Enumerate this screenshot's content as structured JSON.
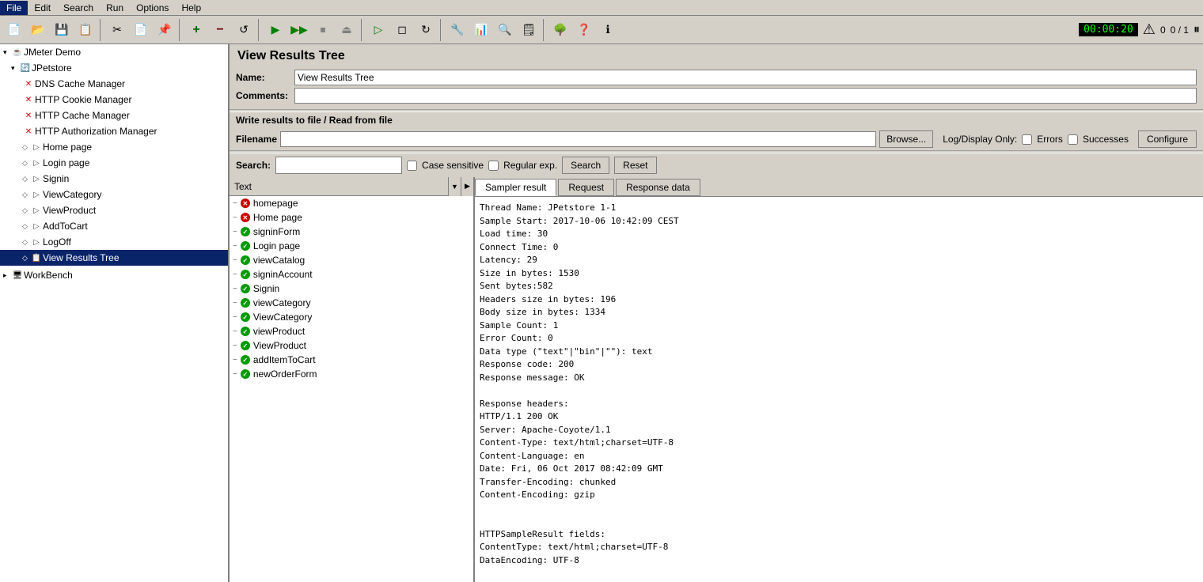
{
  "menubar": {
    "items": [
      "File",
      "Edit",
      "Search",
      "Run",
      "Options",
      "Help"
    ]
  },
  "toolbar": {
    "buttons": [
      {
        "name": "new-btn",
        "icon": "📄"
      },
      {
        "name": "open-btn",
        "icon": "📂"
      },
      {
        "name": "save-btn",
        "icon": "💾"
      },
      {
        "name": "save-as-btn",
        "icon": "💾"
      },
      {
        "name": "cut-btn",
        "icon": "✂"
      },
      {
        "name": "copy-btn",
        "icon": "📋"
      },
      {
        "name": "paste-btn",
        "icon": "📌"
      },
      {
        "name": "sep1",
        "type": "sep"
      },
      {
        "name": "add-btn",
        "icon": "+"
      },
      {
        "name": "remove-btn",
        "icon": "−"
      },
      {
        "name": "clear-btn",
        "icon": "↺"
      },
      {
        "name": "sep2",
        "type": "sep"
      },
      {
        "name": "run-btn",
        "icon": "▶"
      },
      {
        "name": "run-no-stop-btn",
        "icon": "▶▶"
      },
      {
        "name": "stop-btn",
        "icon": "⏹"
      },
      {
        "name": "shutdown-btn",
        "icon": "⏏"
      },
      {
        "name": "sep3",
        "type": "sep"
      },
      {
        "name": "remote-start-btn",
        "icon": "▷"
      },
      {
        "name": "remote-stop-btn",
        "icon": "◻"
      },
      {
        "name": "remote-clear-btn",
        "icon": "↻"
      },
      {
        "name": "sep4",
        "type": "sep"
      },
      {
        "name": "func-test-btn",
        "icon": "🔧"
      },
      {
        "name": "report-btn",
        "icon": "📊"
      },
      {
        "name": "monitor-btn",
        "icon": "🔍"
      },
      {
        "name": "log-btn",
        "icon": "📝"
      },
      {
        "name": "sep5",
        "type": "sep"
      },
      {
        "name": "tree-view-btn",
        "icon": "🌳"
      },
      {
        "name": "help-btn",
        "icon": "❓"
      },
      {
        "name": "info-btn",
        "icon": "ℹ"
      }
    ],
    "timer": "00:00:20",
    "warnings": "0",
    "progress": "0 / 1"
  },
  "tree": {
    "items": [
      {
        "id": "jmeter-demo",
        "label": "JMeter Demo",
        "level": 0,
        "icon": "jmeter",
        "type": "root",
        "expanded": true
      },
      {
        "id": "jpetstore",
        "label": "JPetstore",
        "level": 1,
        "icon": "loop",
        "type": "test-plan",
        "expanded": true
      },
      {
        "id": "dns-cache",
        "label": "DNS Cache Manager",
        "level": 2,
        "icon": "wrench",
        "type": "config"
      },
      {
        "id": "http-cookie",
        "label": "HTTP Cookie Manager",
        "level": 2,
        "icon": "wrench",
        "type": "config"
      },
      {
        "id": "http-cache",
        "label": "HTTP Cache Manager",
        "level": 2,
        "icon": "wrench",
        "type": "config"
      },
      {
        "id": "http-auth",
        "label": "HTTP Authorization Manager",
        "level": 2,
        "icon": "wrench",
        "type": "config"
      },
      {
        "id": "home-page",
        "label": "Home page",
        "level": 2,
        "icon": "loop",
        "type": "sampler"
      },
      {
        "id": "login-page",
        "label": "Login page",
        "level": 2,
        "icon": "loop",
        "type": "sampler"
      },
      {
        "id": "signin",
        "label": "Signin",
        "level": 2,
        "icon": "loop",
        "type": "sampler"
      },
      {
        "id": "view-category",
        "label": "ViewCategory",
        "level": 2,
        "icon": "loop",
        "type": "sampler"
      },
      {
        "id": "view-product",
        "label": "ViewProduct",
        "level": 2,
        "icon": "loop",
        "type": "sampler"
      },
      {
        "id": "add-to-cart",
        "label": "AddToCart",
        "level": 2,
        "icon": "loop",
        "type": "sampler"
      },
      {
        "id": "logoff",
        "label": "LogOff",
        "level": 2,
        "icon": "loop",
        "type": "sampler"
      },
      {
        "id": "view-results-tree",
        "label": "View Results Tree",
        "level": 2,
        "icon": "tree",
        "type": "listener",
        "selected": true
      },
      {
        "id": "workbench",
        "label": "WorkBench",
        "level": 0,
        "icon": "workbench",
        "type": "workbench"
      }
    ]
  },
  "panel": {
    "title": "View Results Tree",
    "name_label": "Name:",
    "name_value": "View Results Tree",
    "comments_label": "Comments:",
    "section_title": "Write results to file / Read from file",
    "filename_label": "Filename",
    "filename_value": "",
    "browse_label": "Browse...",
    "log_display_label": "Log/Display Only:",
    "errors_label": "Errors",
    "successes_label": "Successes",
    "configure_label": "Configure"
  },
  "search": {
    "label": "Search:",
    "placeholder": "",
    "case_sensitive_label": "Case sensitive",
    "regex_label": "Regular exp.",
    "search_button": "Search",
    "reset_button": "Reset"
  },
  "results": {
    "header": "Text",
    "items": [
      {
        "id": "r1",
        "label": "homepage",
        "status": "red"
      },
      {
        "id": "r2",
        "label": "Home page",
        "status": "red"
      },
      {
        "id": "r3",
        "label": "signinForm",
        "status": "green"
      },
      {
        "id": "r4",
        "label": "Login page",
        "status": "green"
      },
      {
        "id": "r5",
        "label": "viewCatalog",
        "status": "green"
      },
      {
        "id": "r6",
        "label": "signinAccount",
        "status": "green"
      },
      {
        "id": "r7",
        "label": "Signin",
        "status": "green"
      },
      {
        "id": "r8",
        "label": "viewCategory",
        "status": "green"
      },
      {
        "id": "r9",
        "label": "ViewCategory",
        "status": "green"
      },
      {
        "id": "r10",
        "label": "viewProduct",
        "status": "green"
      },
      {
        "id": "r11",
        "label": "ViewProduct",
        "status": "green"
      },
      {
        "id": "r12",
        "label": "addItemToCart",
        "status": "green"
      },
      {
        "id": "r13",
        "label": "newOrderForm",
        "status": "green"
      }
    ]
  },
  "detail": {
    "tabs": [
      "Sampler result",
      "Request",
      "Response data"
    ],
    "active_tab": "Sampler result",
    "content": "Thread Name: JPetstore 1-1\nSample Start: 2017-10-06 10:42:09 CEST\nLoad time: 30\nConnect Time: 0\nLatency: 29\nSize in bytes: 1530\nSent bytes:582\nHeaders size in bytes: 196\nBody size in bytes: 1334\nSample Count: 1\nError Count: 0\nData type (\"text\"|\"bin\"|\"\"): text\nResponse code: 200\nResponse message: OK\n\nResponse headers:\nHTTP/1.1 200 OK\nServer: Apache-Coyote/1.1\nContent-Type: text/html;charset=UTF-8\nContent-Language: en\nDate: Fri, 06 Oct 2017 08:42:09 GMT\nTransfer-Encoding: chunked\nContent-Encoding: gzip\n\n\nHTTPSampleResult fields:\nContentType: text/html;charset=UTF-8\nDataEncoding: UTF-8"
  }
}
